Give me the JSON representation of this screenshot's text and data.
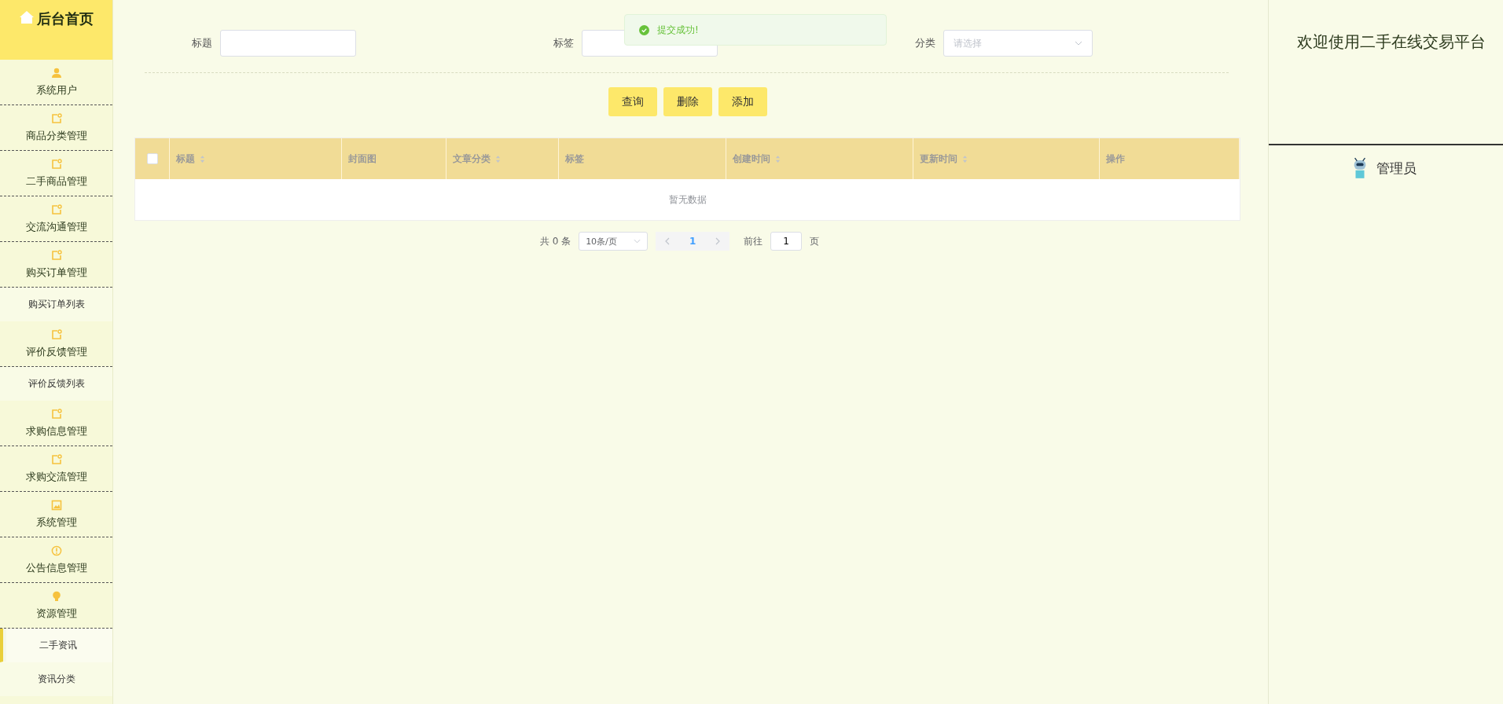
{
  "sidebar": {
    "home": {
      "label": "后台首页"
    },
    "items": [
      {
        "kind": "group",
        "label": "系统用户"
      },
      {
        "kind": "group",
        "label": "商品分类管理"
      },
      {
        "kind": "group",
        "label": "二手商品管理"
      },
      {
        "kind": "group",
        "label": "交流沟通管理"
      },
      {
        "kind": "group",
        "label": "购买订单管理"
      },
      {
        "kind": "sub",
        "label": "购买订单列表",
        "selected": false
      },
      {
        "kind": "group",
        "label": "评价反馈管理"
      },
      {
        "kind": "sub",
        "label": "评价反馈列表",
        "selected": false
      },
      {
        "kind": "group",
        "label": "求购信息管理"
      },
      {
        "kind": "group",
        "label": "求购交流管理"
      },
      {
        "kind": "group",
        "label": "系统管理"
      },
      {
        "kind": "group",
        "label": "公告信息管理"
      },
      {
        "kind": "group",
        "label": "资源管理"
      },
      {
        "kind": "sub",
        "label": "二手资讯",
        "selected": true
      },
      {
        "kind": "sub",
        "label": "资讯分类",
        "selected": false
      }
    ]
  },
  "toast": {
    "text": "提交成功!"
  },
  "filters": [
    {
      "kind": "input",
      "label": "标题"
    },
    {
      "kind": "input",
      "label": "标签"
    },
    {
      "kind": "select",
      "label": "分类",
      "placeholder": "请选择"
    }
  ],
  "buttons": [
    "查询",
    "删除",
    "添加"
  ],
  "table": {
    "columns": [
      {
        "kind": "checkbox",
        "checked": false
      },
      {
        "kind": "text",
        "label": "标题",
        "sortable": true
      },
      {
        "kind": "text",
        "label": "封面图",
        "sortable": false
      },
      {
        "kind": "text",
        "label": "文章分类",
        "sortable": true
      },
      {
        "kind": "text",
        "label": "标签",
        "sortable": false
      },
      {
        "kind": "text",
        "label": "创建时间",
        "sortable": true
      },
      {
        "kind": "text",
        "label": "更新时间",
        "sortable": true
      },
      {
        "kind": "text",
        "label": "操作",
        "sortable": false
      }
    ],
    "empty_text": "暂无数据"
  },
  "pagination": {
    "total": "共 0 条",
    "page_size": "10条/页",
    "pages": [
      {
        "label": "1",
        "selected": true
      }
    ],
    "goto_label": "前往",
    "goto_value": "1",
    "goto_suffix": "页"
  },
  "right_panel": {
    "welcome": "欢迎使用二手在线交易平台",
    "user": "管理员"
  }
}
